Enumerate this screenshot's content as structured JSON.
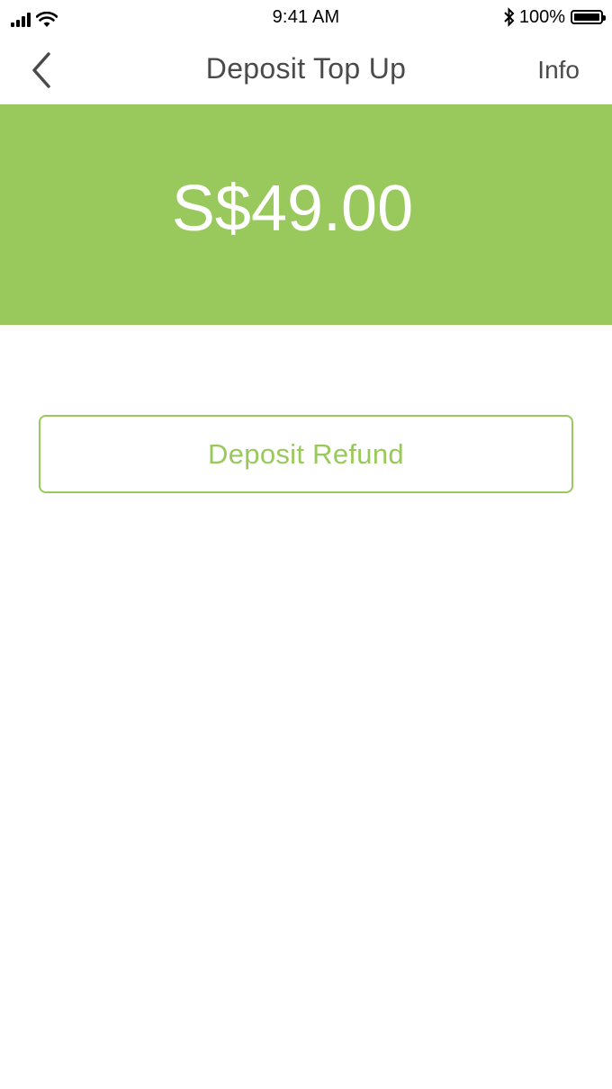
{
  "status_bar": {
    "time": "9:41 AM",
    "battery_percent": "100%",
    "battery_level": 1.0,
    "icons": [
      "cellular-signal-icon",
      "wifi-icon",
      "bluetooth-icon",
      "battery-icon"
    ]
  },
  "nav": {
    "title": "Deposit Top Up",
    "info_label": "Info",
    "back_icon": "chevron-left-icon"
  },
  "balance": {
    "amount": "S$49.00"
  },
  "actions": {
    "refund_label": "Deposit Refund"
  },
  "colors": {
    "accent": "#99c95c",
    "text": "#4a4a4a",
    "background": "#ffffff"
  }
}
